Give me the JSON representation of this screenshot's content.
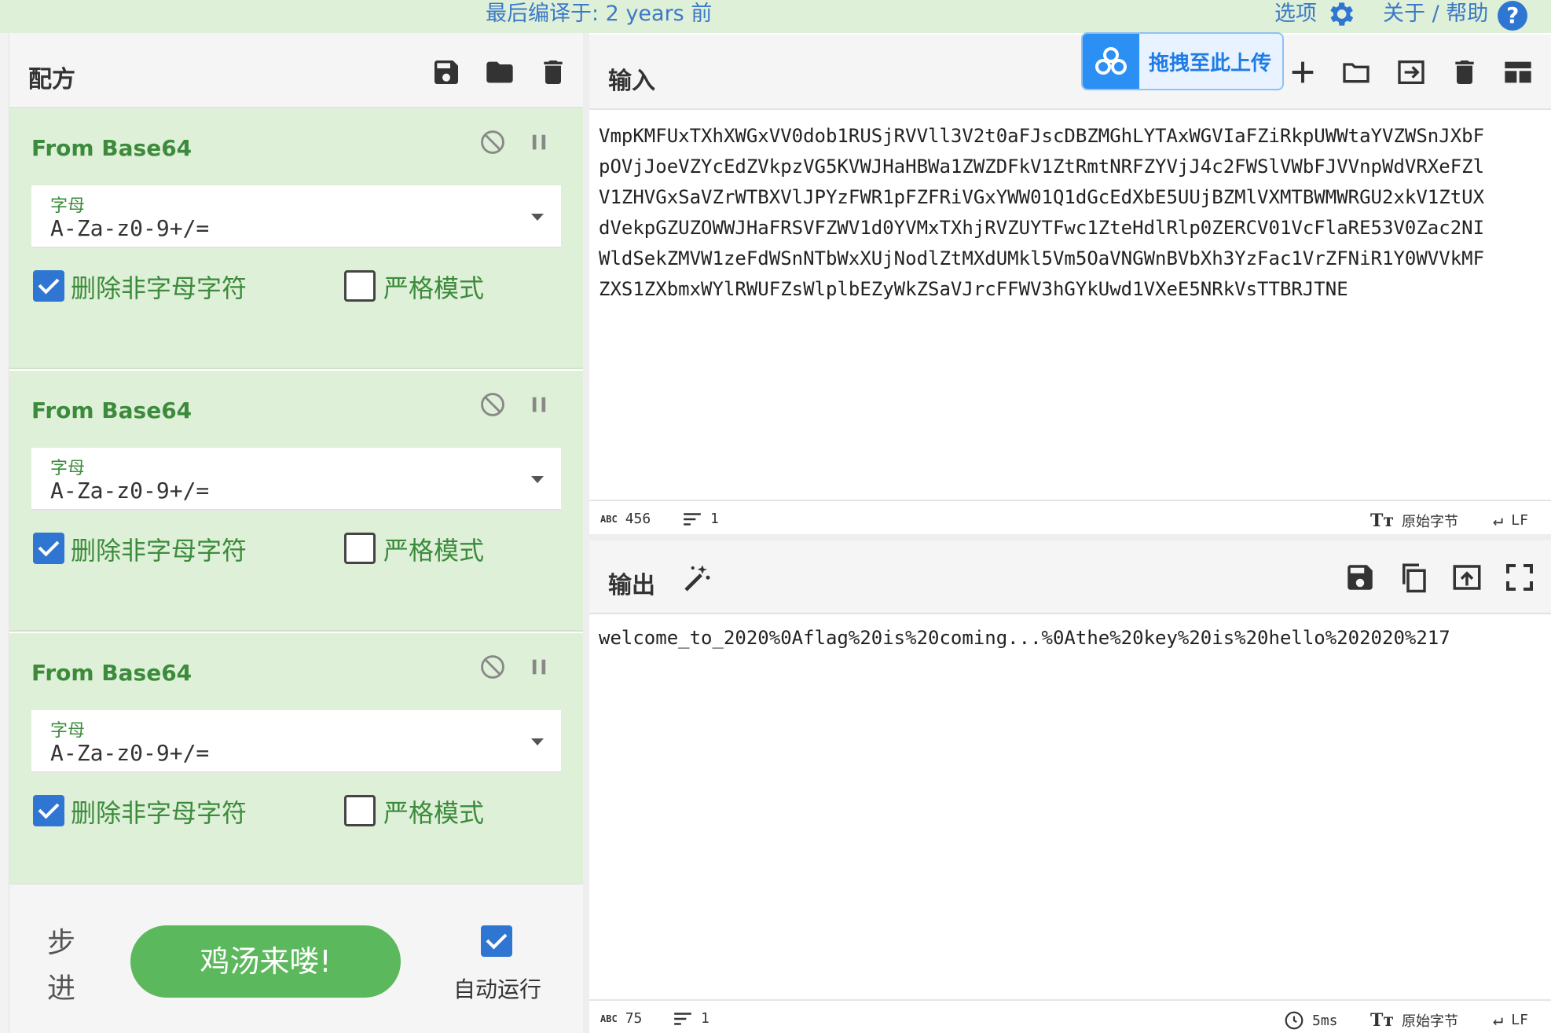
{
  "banner": {
    "version_text": "最后编译于: 2 years 前",
    "options_label": "选项",
    "about_label": "关于 / 帮助"
  },
  "recipe": {
    "title": "配方",
    "operations": [
      {
        "name": "From Base64",
        "field_label": "字母",
        "field_value": "A-Za-z0-9+/=",
        "remove_label": "删除非字母字符",
        "remove_checked": true,
        "strict_label": "严格模式",
        "strict_checked": false
      },
      {
        "name": "From Base64",
        "field_label": "字母",
        "field_value": "A-Za-z0-9+/=",
        "remove_label": "删除非字母字符",
        "remove_checked": true,
        "strict_label": "严格模式",
        "strict_checked": false
      },
      {
        "name": "From Base64",
        "field_label": "字母",
        "field_value": "A-Za-z0-9+/=",
        "remove_label": "删除非字母字符",
        "remove_checked": true,
        "strict_label": "严格模式",
        "strict_checked": false
      }
    ],
    "controls": {
      "step_label": "步进",
      "bake_label": "鸡汤来喽!",
      "auto_bake_label": "自动运行",
      "auto_bake_checked": true
    }
  },
  "input": {
    "title": "输入",
    "upload_label": "拖拽至此上传",
    "lines": [
      "VmpKMFUxTXhXWGxVV0dob1RUSjRVVll3V2t0aFJscDBZMGhLYTAxWGVIaFZiRkpUWWtaYVZWSnJXbF",
      "pOVjJoeVZYcEdZVkpzVG5KVWJHaHBWa1ZWZDFkV1ZtRmtNRFZYVjJ4c2FWSlVWbFJVVnpWdVRXeFZl",
      "V1ZHVGxSaVZrWTBXVlJPYzFWR1pFZFRiVGxYWW01Q1dGcEdXbE5UUjBZMlVXMTBWMWRGU2xkV1ZtUX",
      "dVekpGZUZOWWJHaFRSVFZWV1d0YVMxTXhjRVZUYTFwc1ZteHdlRlp0ZERCV01VcFlaRE53V0Zac2NI",
      "WldSekZMVW1zeFdWSnNTbWxXUjNodlZtMXdUMkl5Vm5OaVNGWnBVbXh3YzFac1VrZFNiR1Y0WVVkMF",
      "ZXS1ZXbmxWYlRWUFZsWlplbEZyWkZSaVJrcFFWV3hGYkUwd1VXeE5NRkVsTTBRJTNE"
    ],
    "status": {
      "chars": "456",
      "lines": "1",
      "encoding": "原始字节",
      "eol": "LF"
    }
  },
  "output": {
    "title": "输出",
    "text": "welcome_to_2020%0Aflag%20is%20coming...%0Athe%20key%20is%20hello%202020%217",
    "status": {
      "chars": "75",
      "lines": "1",
      "time": "5ms",
      "encoding": "原始字节",
      "eol": "LF"
    }
  },
  "colors": {
    "accent_blue": "#2f76d2",
    "op_green_bg": "#dff0d8",
    "op_green_text": "#3c8b3c",
    "bake_green": "#5cb85c"
  }
}
